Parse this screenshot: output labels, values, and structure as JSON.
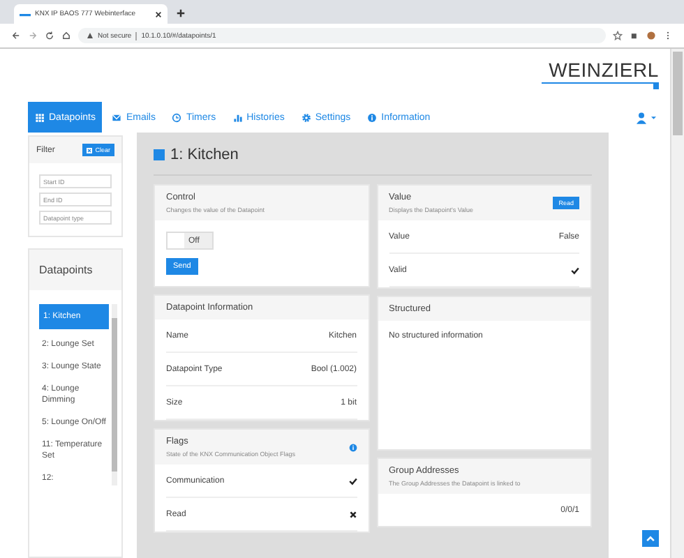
{
  "browser": {
    "tab_title": "KNX IP BAOS 777 Webinterface",
    "security": "Not secure",
    "url": "10.1.0.10/#/datapoints/1"
  },
  "logo": "WEINZIERL",
  "nav": [
    {
      "label": "Datapoints",
      "kind": "grid",
      "selected": true
    },
    {
      "label": "Emails",
      "kind": "mail",
      "selected": false
    },
    {
      "label": "Timers",
      "kind": "clock",
      "selected": false
    },
    {
      "label": "Histories",
      "kind": "chart",
      "selected": false
    },
    {
      "label": "Settings",
      "kind": "gear",
      "selected": false
    },
    {
      "label": "Information",
      "kind": "info",
      "selected": false
    }
  ],
  "filter": {
    "title": "Filter",
    "clear": "Clear",
    "fields": [
      {
        "placeholder": "Start ID"
      },
      {
        "placeholder": "End ID"
      },
      {
        "placeholder": "Datapoint type"
      }
    ]
  },
  "datapoints": {
    "title": "Datapoints",
    "items": [
      {
        "label": "1: Kitchen",
        "selected": true
      },
      {
        "label": "2: Lounge Set",
        "selected": false
      },
      {
        "label": "3: Lounge State",
        "selected": false
      },
      {
        "label": "4: Lounge Dimming",
        "selected": false
      },
      {
        "label": "5: Lounge On/Off",
        "selected": false
      },
      {
        "label": "11: Temperature Set",
        "selected": false
      },
      {
        "label": "12:",
        "selected": false
      }
    ]
  },
  "page_title": "1: Kitchen",
  "control": {
    "title": "Control",
    "subtitle": "Changes the value of the Datapoint",
    "toggle": {
      "label": "Off",
      "on": false
    },
    "send": "Send"
  },
  "value": {
    "title": "Value",
    "subtitle": "Displays the Datapoint's Value",
    "read": "Read",
    "rows": [
      {
        "label": "Value",
        "kind": "text",
        "value": "False"
      },
      {
        "label": "Valid",
        "kind": "flag",
        "on": true
      }
    ]
  },
  "info": {
    "title": "Datapoint Information",
    "rows": [
      {
        "label": "Name",
        "value": "Kitchen"
      },
      {
        "label": "Datapoint Type",
        "value": "Bool (1.002)"
      },
      {
        "label": "Size",
        "value": "1 bit"
      }
    ]
  },
  "structured": {
    "title": "Structured",
    "text": "No structured information"
  },
  "flags": {
    "title": "Flags",
    "subtitle": "State of the KNX Communication Object Flags",
    "rows": [
      {
        "label": "Communication",
        "on": true
      },
      {
        "label": "Read",
        "on": false
      }
    ]
  },
  "groups": {
    "title": "Group Addresses",
    "subtitle": "The Group Addresses the Datapoint is linked to",
    "addresses": [
      "0/0/1"
    ]
  }
}
